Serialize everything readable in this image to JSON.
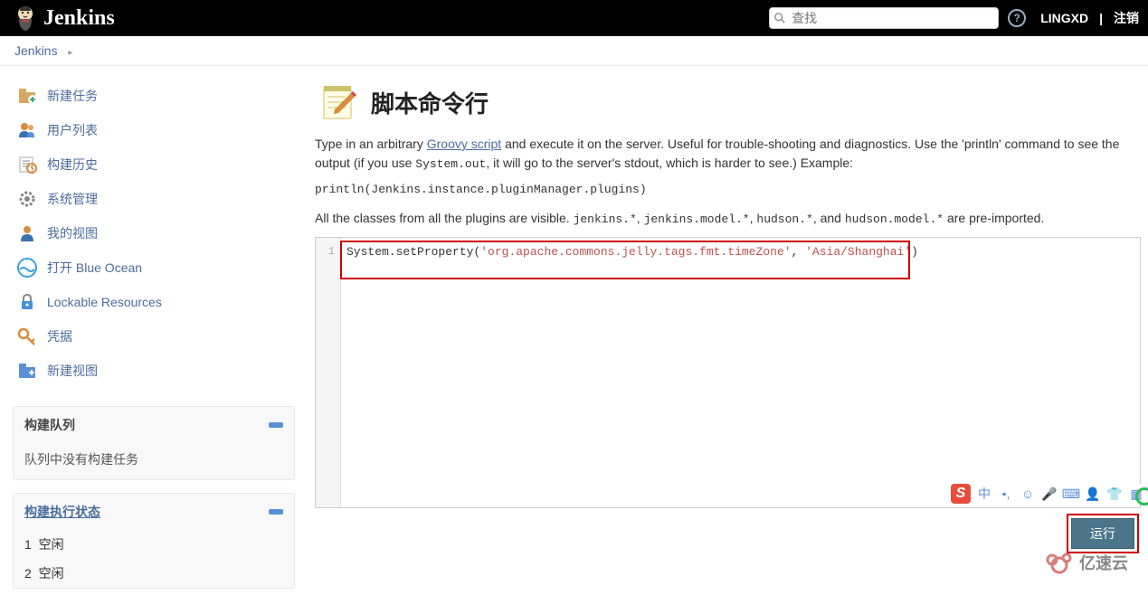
{
  "header": {
    "app_name": "Jenkins",
    "search_placeholder": "查找",
    "user": "LINGXD",
    "logout": "注销"
  },
  "breadcrumb": {
    "root": "Jenkins"
  },
  "sidebar": {
    "items": [
      {
        "label": "新建任务"
      },
      {
        "label": "用户列表"
      },
      {
        "label": "构建历史"
      },
      {
        "label": "系统管理"
      },
      {
        "label": "我的视图"
      },
      {
        "label": "打开 Blue Ocean"
      },
      {
        "label": "Lockable Resources"
      },
      {
        "label": "凭据"
      },
      {
        "label": "新建视图"
      }
    ],
    "queue": {
      "title": "构建队列",
      "empty": "队列中没有构建任务"
    },
    "executors": {
      "title": "构建执行状态",
      "rows": [
        {
          "n": "1",
          "label": "空闲"
        },
        {
          "n": "2",
          "label": "空闲"
        }
      ]
    }
  },
  "main": {
    "title": "脚本命令行",
    "desc_prefix": "Type in an arbitrary ",
    "groovy_link": "Groovy script",
    "desc_mid": " and execute it on the server. Useful for trouble-shooting and diagnostics. Use the 'println' command to see the output (if you use ",
    "system_out": "System.out",
    "desc_suffix": ", it will go to the server's stdout, which is harder to see.) Example:",
    "example_code": "println(Jenkins.instance.pluginManager.plugins)",
    "imports_prefix": "All the classes from all the plugins are visible. ",
    "imp1": "jenkins.*",
    "sep": ", ",
    "imp2": "jenkins.model.*",
    "imp3": "hudson.*",
    "and": ", and ",
    "imp4": "hudson.model.*",
    "imports_suffix": " are pre-imported.",
    "editor_line": "1",
    "code_pre": "System.setProperty(",
    "code_arg1": "'org.apache.commons.jelly.tags.fmt.timeZone'",
    "code_comma": ", ",
    "code_arg2": "'Asia/Shanghai'",
    "code_post": ")",
    "run_label": "运行"
  },
  "ime": {
    "s": "S",
    "zh": "中"
  },
  "watermark_text": "亿速云"
}
